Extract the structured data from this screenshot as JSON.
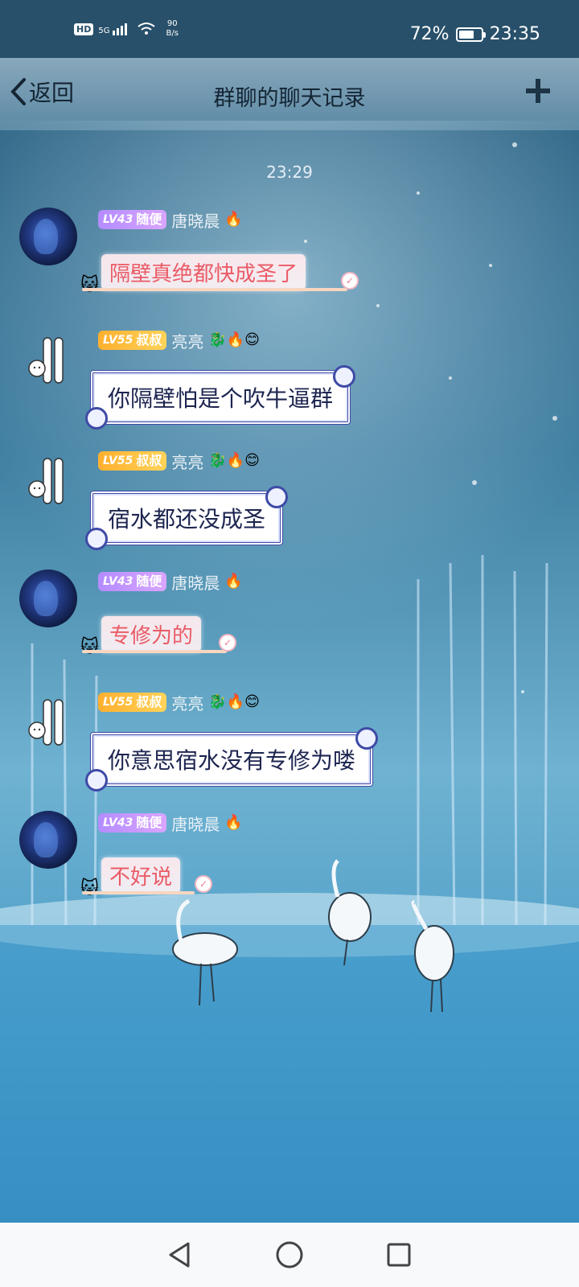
{
  "status_bar": {
    "hd": "HD",
    "signal": "5G",
    "net_speed_value": "90",
    "net_speed_unit": "B/s",
    "battery_percent": "72%",
    "battery_level": 0.72,
    "time": "23:35"
  },
  "nav": {
    "back_label": "返回",
    "title": "群聊的聊天记录",
    "plus_icon": "plus-icon"
  },
  "chat": {
    "timestamp": "23:29",
    "messages": [
      {
        "level": "LV43",
        "title": "随便",
        "sender": "唐晓晨",
        "badges": "🔥",
        "text": "隔壁真绝都快成圣了",
        "style": "pink",
        "avatar": "galaxy"
      },
      {
        "level": "LV55",
        "title": "叔叔",
        "sender": "亮亮",
        "badges": "🐉🔥😊",
        "text": "你隔壁怕是个吹牛逼群",
        "style": "blue",
        "avatar": "doodle"
      },
      {
        "level": "LV55",
        "title": "叔叔",
        "sender": "亮亮",
        "badges": "🐉🔥😊",
        "text": "宿水都还没成圣",
        "style": "blue",
        "avatar": "doodle"
      },
      {
        "level": "LV43",
        "title": "随便",
        "sender": "唐晓晨",
        "badges": "🔥",
        "text": "专修为的",
        "style": "pink",
        "avatar": "galaxy"
      },
      {
        "level": "LV55",
        "title": "叔叔",
        "sender": "亮亮",
        "badges": "🐉🔥😊",
        "text": "你意思宿水没有专修为喽",
        "style": "blue",
        "avatar": "doodle"
      },
      {
        "level": "LV43",
        "title": "随便",
        "sender": "唐晓晨",
        "badges": "🔥",
        "text": "不好说",
        "style": "pink",
        "avatar": "galaxy"
      }
    ]
  },
  "colors": {
    "status_bar": "#28506a",
    "pink_text": "#ea5b66",
    "blue_border": "#3e4aa6",
    "lv_purple": "#c59cff",
    "lv_orange": "#ffc13d"
  },
  "bottom_nav": [
    "back-triangle-icon",
    "home-circle-icon",
    "recents-square-icon"
  ]
}
